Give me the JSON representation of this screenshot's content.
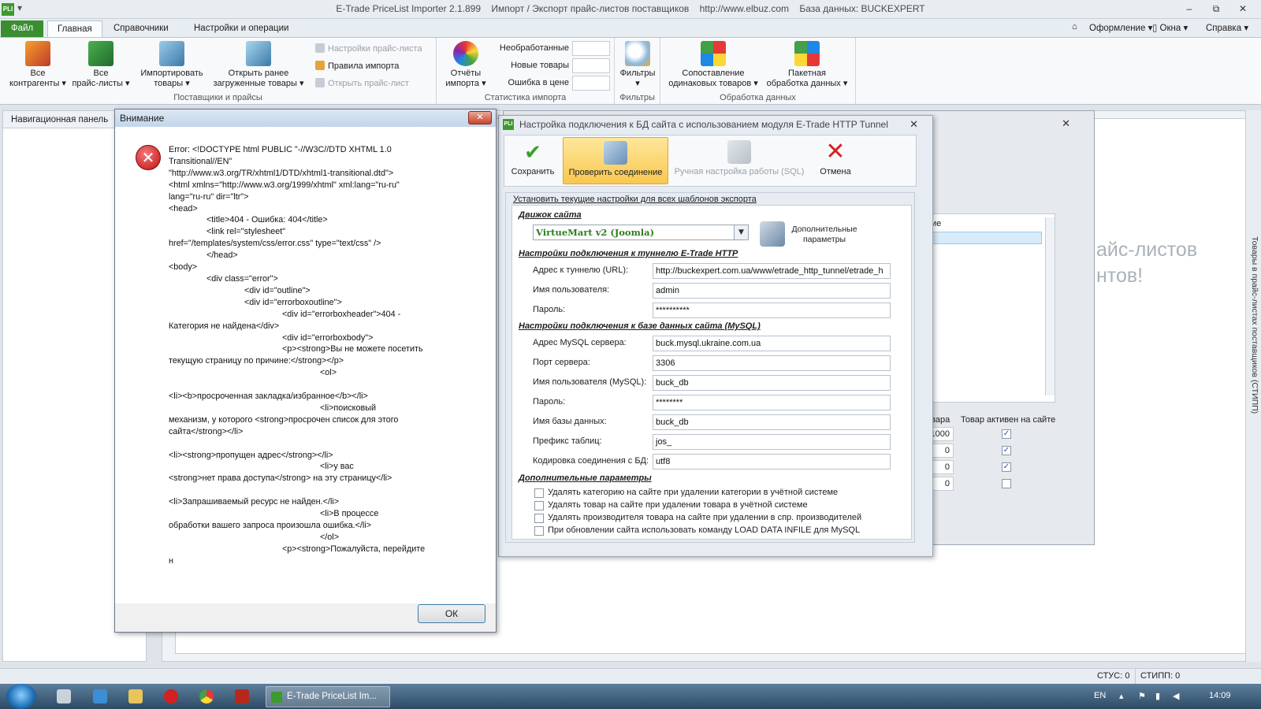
{
  "app": {
    "title": "E-Trade PriceList Importer 2.1.899    Импорт / Экспорт прайс-листов поставщиков    http://www.elbuz.com    База данных: BUCKEXPERT",
    "icon_label": "PLI"
  },
  "window_controls": {
    "minimize": "–",
    "maximize": "⧉",
    "close": "✕"
  },
  "ribbon_tabs": {
    "file": "Файл",
    "tabs": [
      "Главная",
      "Справочники",
      "Настройки и операции"
    ],
    "right_menu": [
      "Оформление",
      "Окна",
      "Справка"
    ]
  },
  "ribbon": {
    "groups": [
      {
        "title": "Поставщики и прайсы"
      },
      {
        "title": "Статистика импорта"
      },
      {
        "title": "Фильтры"
      },
      {
        "title": "Обработка данных"
      }
    ],
    "buttons": {
      "all_contractors": [
        "Все",
        "контрагенты"
      ],
      "all_pricelists": [
        "Все",
        "прайс-листы"
      ],
      "import_goods": [
        "Импортировать",
        "товары"
      ],
      "open_loaded": [
        "Открыть ранее",
        "загруженные товары"
      ],
      "import_reports": [
        "Отчёты",
        "импорта"
      ],
      "filters": [
        "Фильтры"
      ],
      "match_goods": [
        "Сопоставление",
        "одинаковых товаров"
      ],
      "batch_processing": [
        "Пакетная",
        "обработка данных"
      ]
    },
    "small": {
      "pricelist_settings": "Настройки прайс-листа",
      "import_rules": "Правила импорта",
      "open_pricelist": "Открыть прайс-лист"
    },
    "stats": [
      "Необработанные",
      "Новые товары",
      "Ошибка в цене"
    ]
  },
  "nav_panel": {
    "title": "Навигационная панель"
  },
  "background_text": [
    "айс-листов",
    "нтов!"
  ],
  "side_tab": "Товары в прайс-листах поставщиков (СТИПП)",
  "status_bar": {
    "left": "СТУС: 0",
    "right": "СТИПП: 0"
  },
  "taskbar": {
    "task": "E-Trade PriceList Im...",
    "lang": "EN",
    "time": "14:09"
  },
  "dialog": {
    "title": "Внимание",
    "ok": "ОК",
    "message": "Error: <!DOCTYPE html PUBLIC \"-//W3C//DTD XHTML 1.0\nTransitional//EN\"\n\"http://www.w3.org/TR/xhtml1/DTD/xhtml1-transitional.dtd\">\n<html xmlns=\"http://www.w3.org/1999/xhtml\" xml:lang=\"ru-ru\"\nlang=\"ru-ru\" dir=\"ltr\">\n<head>\n                <title>404 - Ошибка: 404</title>\n                <link rel=\"stylesheet\"\nhref=\"/templates/system/css/error.css\" type=\"text/css\" />\n                </head>\n<body>\n                <div class=\"error\">\n                                <div id=\"outline\">\n                                <div id=\"errorboxoutline\">\n                                                <div id=\"errorboxheader\">404 -\nКатегория не найдена</div>\n                                                <div id=\"errorboxbody\">\n                                                <p><strong>Вы не можете посетить\nтекущую страницу по причине:</strong></p>\n                                                                <ol>\n\n<li><b>просроченная закладка/избранное</b></li>\n                                                                <li>поисковый\nмеханизм, у которого <strong>просрочен список для этого\nсайта</strong></li>\n\n<li><strong>пропущен адрес</strong></li>\n                                                                <li>у вас\n<strong>нет права доступа</strong> на эту страницу</li>\n\n<li>Запрашиваемый ресурс не найден.</li>\n                                                                <li>В процессе\nобработки вашего запроса произошла ошибка.</li>\n                                                                </ol>\n                                                <p><strong>Пожалуйста, перейдите\nн"
  },
  "settings": {
    "title": "Настройка подключения к БД сайта с использованием модуля E-Trade HTTP Tunnel",
    "toolbar": {
      "save": "Сохранить",
      "test": "Проверить соединение",
      "manual_sql": "Ручная настройка работы (SQL)",
      "cancel": "Отмена"
    },
    "apply_all": "Установить текущие настройки для всех шаблонов экспорта",
    "engine_section": "Движок сайта",
    "engine_value": "VirtueMart v2 (Joomla)",
    "extra_params_btn": [
      "Дополнительные",
      "параметры"
    ],
    "tunnel_section": "Настройки подключения к туннелю E-Trade HTTP",
    "tunnel_fields": [
      {
        "label": "Адрес к туннелю (URL):",
        "value": "http://buckexpert.com.ua/www/etrade_http_tunnel/etrade_h"
      },
      {
        "label": "Имя пользователя:",
        "value": "admin"
      },
      {
        "label": "Пароль:",
        "value": "**********"
      }
    ],
    "mysql_section": "Настройки подключения к базе данных сайта (MySQL)",
    "mysql_fields": [
      {
        "label": "Адрес MySQL сервера:",
        "value": "buck.mysql.ukraine.com.ua"
      },
      {
        "label": "Порт сервера:",
        "value": "3306"
      },
      {
        "label": "Имя пользователя (MySQL):",
        "value": "buck_db"
      },
      {
        "label": "Пароль:",
        "value": "********"
      },
      {
        "label": "Имя базы данных:",
        "value": "buck_db"
      },
      {
        "label": "Префикс таблиц:",
        "value": "jos_"
      },
      {
        "label": "Кодировка соединения с БД:",
        "value": "utf8"
      }
    ],
    "extra_section": "Дополнительные параметры",
    "options": [
      "Удалять категорию на сайте при удалении категории в учётной системе",
      "Удалять товар на сайте при удалении товара в учётной системе",
      "Удалять производителя товара на сайте при удалении в спр. производителей",
      "При обновлении сайта использовать команду LOAD DATA INFILE для MySQL"
    ]
  },
  "back_grid": {
    "header_fragment": "ие",
    "col1_header": "овара",
    "col2_header": "Товар активен на сайте",
    "rows": [
      {
        "qty": "1000",
        "active": "✓"
      },
      {
        "qty": "0",
        "active": "✓"
      },
      {
        "qty": "0",
        "active": "✓"
      },
      {
        "qty": "0",
        "active": ""
      }
    ]
  },
  "colors": {
    "accent_green": "#3a8e30",
    "highlight": "#f9c74f",
    "error_red": "#c40d0d"
  }
}
